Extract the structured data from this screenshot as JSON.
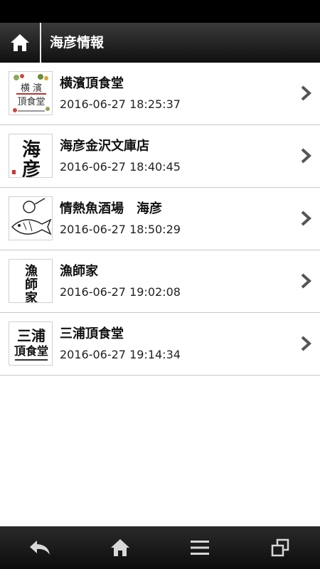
{
  "header": {
    "title": "海彦情報"
  },
  "items": [
    {
      "name": "横濱頂食堂",
      "date": "2016-06-27 18:25:37",
      "logo_text": "横濱頂食堂"
    },
    {
      "name": "海彦金沢文庫店",
      "date": "2016-06-27 18:40:45",
      "logo_text": "海彦"
    },
    {
      "name": "情熱魚酒場　海彦",
      "date": "2016-06-27 18:50:29",
      "logo_text": ""
    },
    {
      "name": "漁師家",
      "date": "2016-06-27 19:02:08",
      "logo_text": "漁師家"
    },
    {
      "name": "三浦頂食堂",
      "date": "2016-06-27 19:14:34",
      "logo_text": "三浦頂食堂"
    }
  ],
  "bottom_nav": [
    "back-icon",
    "home-icon",
    "menu-icon",
    "windows-icon"
  ]
}
